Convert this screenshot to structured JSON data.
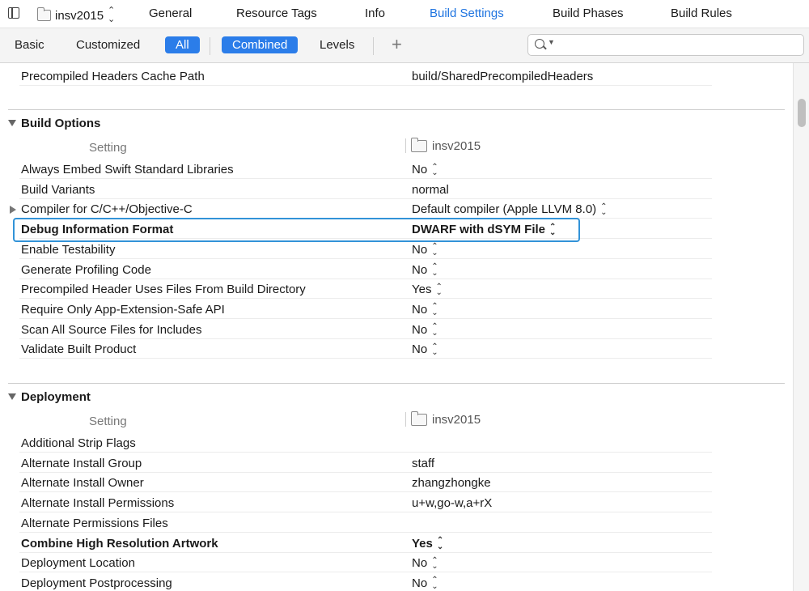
{
  "tabbar": {
    "target": "insv2015",
    "tabs": [
      {
        "label": "General",
        "active": false
      },
      {
        "label": "Resource Tags",
        "active": false
      },
      {
        "label": "Info",
        "active": false
      },
      {
        "label": "Build Settings",
        "active": true
      },
      {
        "label": "Build Phases",
        "active": false
      },
      {
        "label": "Build Rules",
        "active": false
      }
    ]
  },
  "filterbar": {
    "basic": "Basic",
    "customized": "Customized",
    "all": "All",
    "combined": "Combined",
    "levels": "Levels",
    "add": "+",
    "search_placeholder": ""
  },
  "top_row": {
    "name": "Precompiled Headers Cache Path",
    "value": "build/SharedPrecompiledHeaders"
  },
  "build_options": {
    "title": "Build Options",
    "setting_header": "Setting",
    "target_header": "insv2015",
    "rows": [
      {
        "name": "Always Embed Swift Standard Libraries",
        "value": "No",
        "popup": true
      },
      {
        "name": "Build Variants",
        "value": "normal",
        "popup": false
      },
      {
        "name": "Compiler for C/C++/Objective-C",
        "value": "Default compiler (Apple LLVM 8.0)",
        "popup": true,
        "expandable": true
      },
      {
        "name": "Debug Information Format",
        "value": "DWARF with dSYM File",
        "popup": true,
        "bold": true,
        "highlighted": true
      },
      {
        "name": "Enable Testability",
        "value": "No",
        "popup": true
      },
      {
        "name": "Generate Profiling Code",
        "value": "No",
        "popup": true
      },
      {
        "name": "Precompiled Header Uses Files From Build Directory",
        "value": "Yes",
        "popup": true
      },
      {
        "name": "Require Only App-Extension-Safe API",
        "value": "No",
        "popup": true
      },
      {
        "name": "Scan All Source Files for Includes",
        "value": "No",
        "popup": true
      },
      {
        "name": "Validate Built Product",
        "value": "No",
        "popup": true
      }
    ]
  },
  "deployment": {
    "title": "Deployment",
    "setting_header": "Setting",
    "target_header": "insv2015",
    "rows": [
      {
        "name": "Additional Strip Flags",
        "value": "",
        "popup": false
      },
      {
        "name": "Alternate Install Group",
        "value": "staff",
        "popup": false
      },
      {
        "name": "Alternate Install Owner",
        "value": "zhangzhongke",
        "popup": false
      },
      {
        "name": "Alternate Install Permissions",
        "value": "u+w,go-w,a+rX",
        "popup": false
      },
      {
        "name": "Alternate Permissions Files",
        "value": "",
        "popup": false
      },
      {
        "name": "Combine High Resolution Artwork",
        "value": "Yes",
        "popup": true,
        "bold": true
      },
      {
        "name": "Deployment Location",
        "value": "No",
        "popup": true
      },
      {
        "name": "Deployment Postprocessing",
        "value": "No",
        "popup": true
      }
    ]
  },
  "colors": {
    "accent": "#2b7de9",
    "highlight_border": "#3293d8",
    "active_tab": "#1f74e0"
  }
}
